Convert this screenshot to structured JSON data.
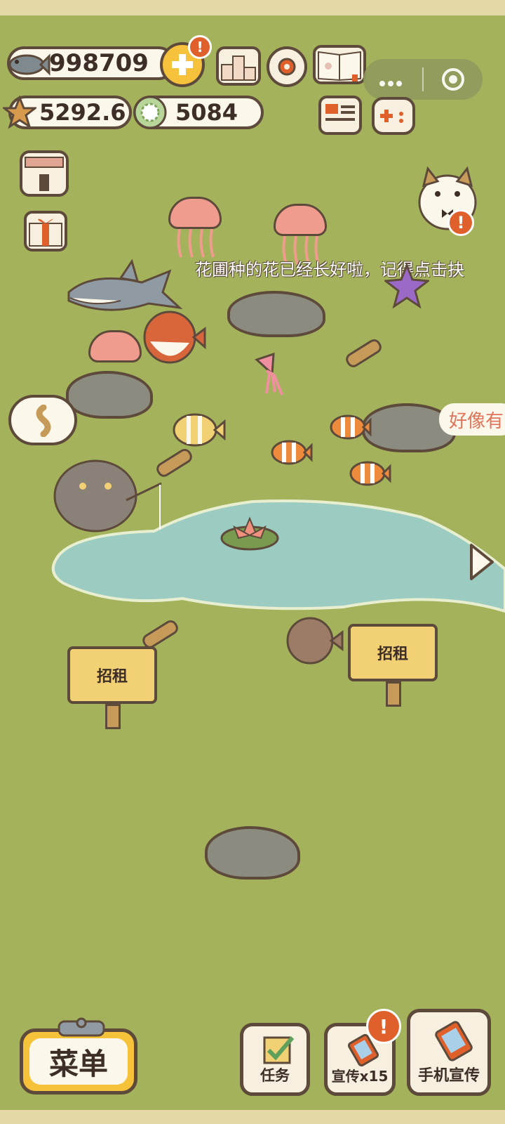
{
  "currency": {
    "fish": "998709",
    "starfish": "5292.6",
    "shell": "5084"
  },
  "ticker": "花圃种的花已经长好啦，记得点击抉",
  "hint_bubble": "好像有",
  "signs": [
    "招租",
    "招租"
  ],
  "bottom": {
    "menu": "菜单",
    "tasks": "任务",
    "promo": "宣传x15",
    "phone_promo": "手机宣传"
  },
  "alert_symbol": "!",
  "colors": {
    "grass": "#a4b35b",
    "pond": "#9ccbc2",
    "outline": "#5d4a3a",
    "accent": "#f7c23b",
    "alert": "#e0602c"
  }
}
